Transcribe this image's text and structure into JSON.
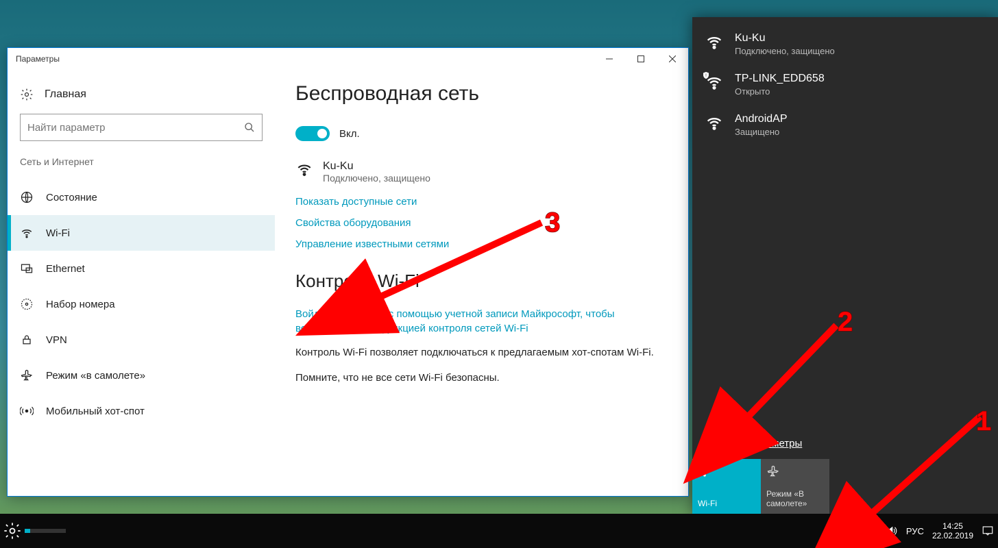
{
  "settings": {
    "window_title": "Параметры",
    "home_label": "Главная",
    "search_placeholder": "Найти параметр",
    "section_label": "Сеть и Интернет",
    "nav": [
      {
        "key": "status",
        "label": "Состояние"
      },
      {
        "key": "wifi",
        "label": "Wi-Fi"
      },
      {
        "key": "ethernet",
        "label": "Ethernet"
      },
      {
        "key": "dialup",
        "label": "Набор номера"
      },
      {
        "key": "vpn",
        "label": "VPN"
      },
      {
        "key": "airplane",
        "label": "Режим «в самолете»"
      },
      {
        "key": "hotspot",
        "label": "Мобильный хот-спот"
      }
    ],
    "content": {
      "heading_wireless": "Беспроводная сеть",
      "toggle_state": "Вкл.",
      "current_network": {
        "name": "Ku-Ku",
        "status": "Подключено, защищено"
      },
      "link_show_networks": "Показать доступные сети",
      "link_hardware_props": "Свойства оборудования",
      "link_manage_known": "Управление известными сетями",
      "heading_control": "Контроль Wi-Fi",
      "link_signin": "Войдите в систему с помощью учетной записи Майкрософт, чтобы воспользоваться функцией контроля сетей Wi-Fi",
      "text_control1": "Контроль Wi-Fi позволяет подключаться к предлагаемым хот-спотам Wi-Fi.",
      "text_control2": "Помните, что не все сети Wi-Fi безопасны."
    }
  },
  "flyout": {
    "networks": [
      {
        "name": "Ku-Ku",
        "status": "Подключено, защищено",
        "secured": true,
        "open_warn": false
      },
      {
        "name": "TP-LINK_EDD658",
        "status": "Открыто",
        "secured": false,
        "open_warn": true
      },
      {
        "name": "AndroidAP",
        "status": "Защищено",
        "secured": true,
        "open_warn": false
      }
    ],
    "settings_link": "Сетевые параметры",
    "tile_wifi": "Wi-Fi",
    "tile_airplane": "Режим «В самолете»"
  },
  "taskbar": {
    "lang": "РУС",
    "time": "14:25",
    "date": "22.02.2019"
  },
  "annotations": {
    "n1": "1",
    "n2": "2",
    "n3": "3"
  }
}
